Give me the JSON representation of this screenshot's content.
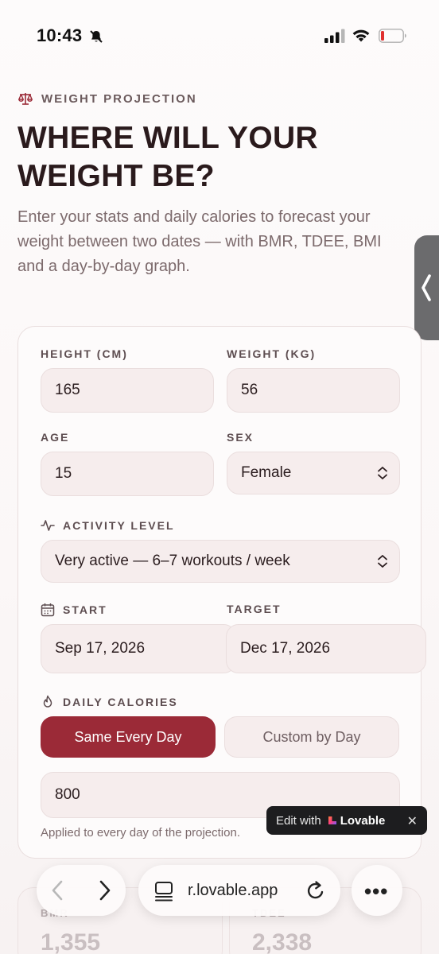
{
  "status_bar": {
    "time": "10:43"
  },
  "header": {
    "eyebrow": "WEIGHT PROJECTION",
    "title": "WHERE WILL YOUR WEIGHT BE?",
    "subtitle": "Enter your stats and daily calories to forecast your\nweight between two dates — with BMR, TDEE, BMI\nand a day-by-day graph."
  },
  "form": {
    "height": {
      "label": "HEIGHT (CM)",
      "value": "165"
    },
    "weight": {
      "label": "WEIGHT (KG)",
      "value": "56"
    },
    "age": {
      "label": "AGE",
      "value": "15"
    },
    "sex": {
      "label": "SEX",
      "value": "Female"
    },
    "activity": {
      "label": "ACTIVITY LEVEL",
      "value": "Very active — 6–7 workouts / week"
    },
    "start": {
      "label": "START",
      "value": "Sep 17, 2026"
    },
    "target": {
      "label": "TARGET",
      "value": "Dec 17, 2026"
    },
    "calories": {
      "label": "DAILY CALORIES",
      "mode_same": "Same Every Day",
      "mode_custom": "Custom by Day",
      "active_mode": "Same Every Day",
      "value": "800",
      "helper": "Applied to every day of the projection."
    }
  },
  "badge": {
    "edit": "Edit with",
    "brand": "Lovable",
    "close": "✕"
  },
  "stats": [
    {
      "label": "BMR",
      "value": "1,355"
    },
    {
      "label": "TDEE",
      "value": "2,338"
    }
  ],
  "browser": {
    "url": "r.lovable.app"
  },
  "colors": {
    "accent": "#9b2a37",
    "field_bg": "#f6eded",
    "text": "#2b1d1f"
  }
}
